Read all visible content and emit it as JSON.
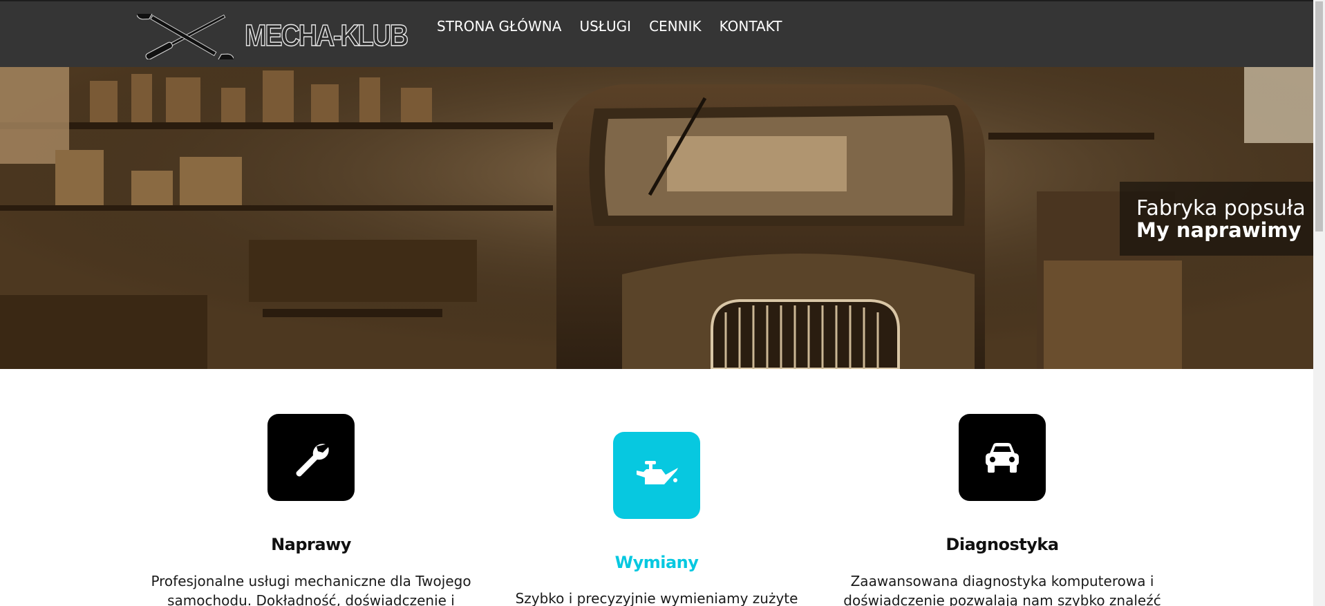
{
  "brand": {
    "name": "MECHA-KLUB",
    "logo_icon": "crossed-tools-icon"
  },
  "nav": {
    "items": [
      {
        "label": "STRONA GŁÓWNA"
      },
      {
        "label": "USŁUGI"
      },
      {
        "label": "CENNIK"
      },
      {
        "label": "KONTAKT"
      }
    ]
  },
  "hero": {
    "caption_line1": "Fabryka popsuła",
    "caption_line2": "My naprawimy"
  },
  "services": [
    {
      "title": "Naprawy",
      "icon": "wrench-icon",
      "description": "Profesjonalne usługi mechaniczne dla Twojego samochodu. Dokładność, doświadczenie i",
      "active": false
    },
    {
      "title": "Wymiany",
      "icon": "oil-can-icon",
      "description": "Szybko i precyzyjnie wymieniamy zużyte części,",
      "active": true
    },
    {
      "title": "Diagnostyka",
      "icon": "car-icon",
      "description": "Zaawansowana diagnostyka komputerowa i doświadczenie pozwalają nam szybko znaleźć",
      "active": false
    }
  ],
  "colors": {
    "header_bg": "#353535",
    "accent": "#07c8e0",
    "tile": "#000000",
    "hero_tone": "#6b4c2a"
  }
}
